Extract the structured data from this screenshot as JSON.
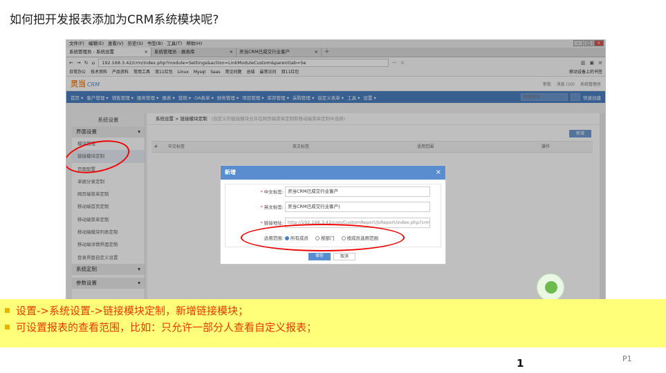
{
  "slide": {
    "title": "如何把开发报表添加为CRM系统模块呢?",
    "notes": [
      "设置->系统设置->链接模块定制，新增链接模块；",
      "可设置报表的查看范围，比如：只允许一部分人查看自定义报表；"
    ],
    "page_label": "P1",
    "page_number": "1"
  },
  "browser": {
    "menu": [
      "文件(F)",
      "编辑(E)",
      "查看(V)",
      "历史(S)",
      "书签(B)",
      "工具(T)",
      "帮助(H)"
    ],
    "tabs": [
      {
        "label": "系统管理员 - 系统设置",
        "close": "×"
      },
      {
        "label": "系统管理员 - 报表库",
        "close": "×"
      },
      {
        "label": "灵当CRM已成交行业客户",
        "close": "×"
      }
    ],
    "new_tab": "+",
    "url": "192.168.3.42/crm/index.php?module=Settings&action=LinkModuleCustom&parenttab=Se",
    "bookmarks": [
      "日常办公",
      "技术资料",
      "产品资料",
      "常用工具",
      "双11红包",
      "Linux",
      "Mysql",
      "Saas",
      "常见问题",
      "总结",
      "最常访问",
      "双11红包"
    ],
    "bookmarks_right": "移动设备上的书签"
  },
  "app": {
    "logo": "灵当",
    "logo_suffix": "CRM",
    "header_right": [
      "审批",
      "消息 (10)",
      "系统管理员"
    ],
    "nav": [
      "首页 ▾",
      "客户管理 ▾",
      "销售管理 ▾",
      "服务管理 ▾",
      "报表 ▾",
      "营销 ▾",
      "OA表单 ▾",
      "财务管理 ▾",
      "项目管理 ▾",
      "库存管理 ▾",
      "采购管理 ▾",
      "自定义表单 ▾",
      "工具 ▾",
      "设置 ▾"
    ],
    "search_placeholder": "快速查找",
    "quick_create": "快速创建"
  },
  "sidebar": {
    "title": "系统设置",
    "group1": "界面设置",
    "items": [
      "模块管理",
      "链接模块定制",
      "页面配置",
      "单据分录定制",
      "网页端菜单定制",
      "移动端首页定制",
      "移动端菜单定制",
      "移动端模块列表定制",
      "移动端详情界面定制",
      "登录界面自定义设置"
    ],
    "group2": "系统定制",
    "group3": "参数设置"
  },
  "content": {
    "breadcrumb": "系统设置 > 链接模块定制",
    "hint": "(自定义的链接模块允许在网页端菜单定制和移动端菜单定制中选择)",
    "new_button": "新增",
    "columns": [
      "#",
      "中文标签",
      "英文标签",
      "适用范围",
      "操作"
    ]
  },
  "modal": {
    "title": "新增",
    "fields": [
      {
        "label": "中文标签:",
        "value": "灵当CRM已成交行业客户"
      },
      {
        "label": "英文标签:",
        "value": "灵当CRM已成交行业客户|"
      },
      {
        "label": "链接地址:",
        "value": "http://192.168.3.42/crm/CustomReport/JsReport/index.php?crm_r"
      }
    ],
    "scope_label": "适用范围:",
    "scope_options": [
      "所有成员",
      "按部门",
      "按成员选用范围"
    ],
    "save": "保存",
    "cancel": "取消"
  },
  "colors": {
    "accent": "#4a7fc1",
    "highlight": "#ffff7a",
    "annotation": "#e00000"
  }
}
